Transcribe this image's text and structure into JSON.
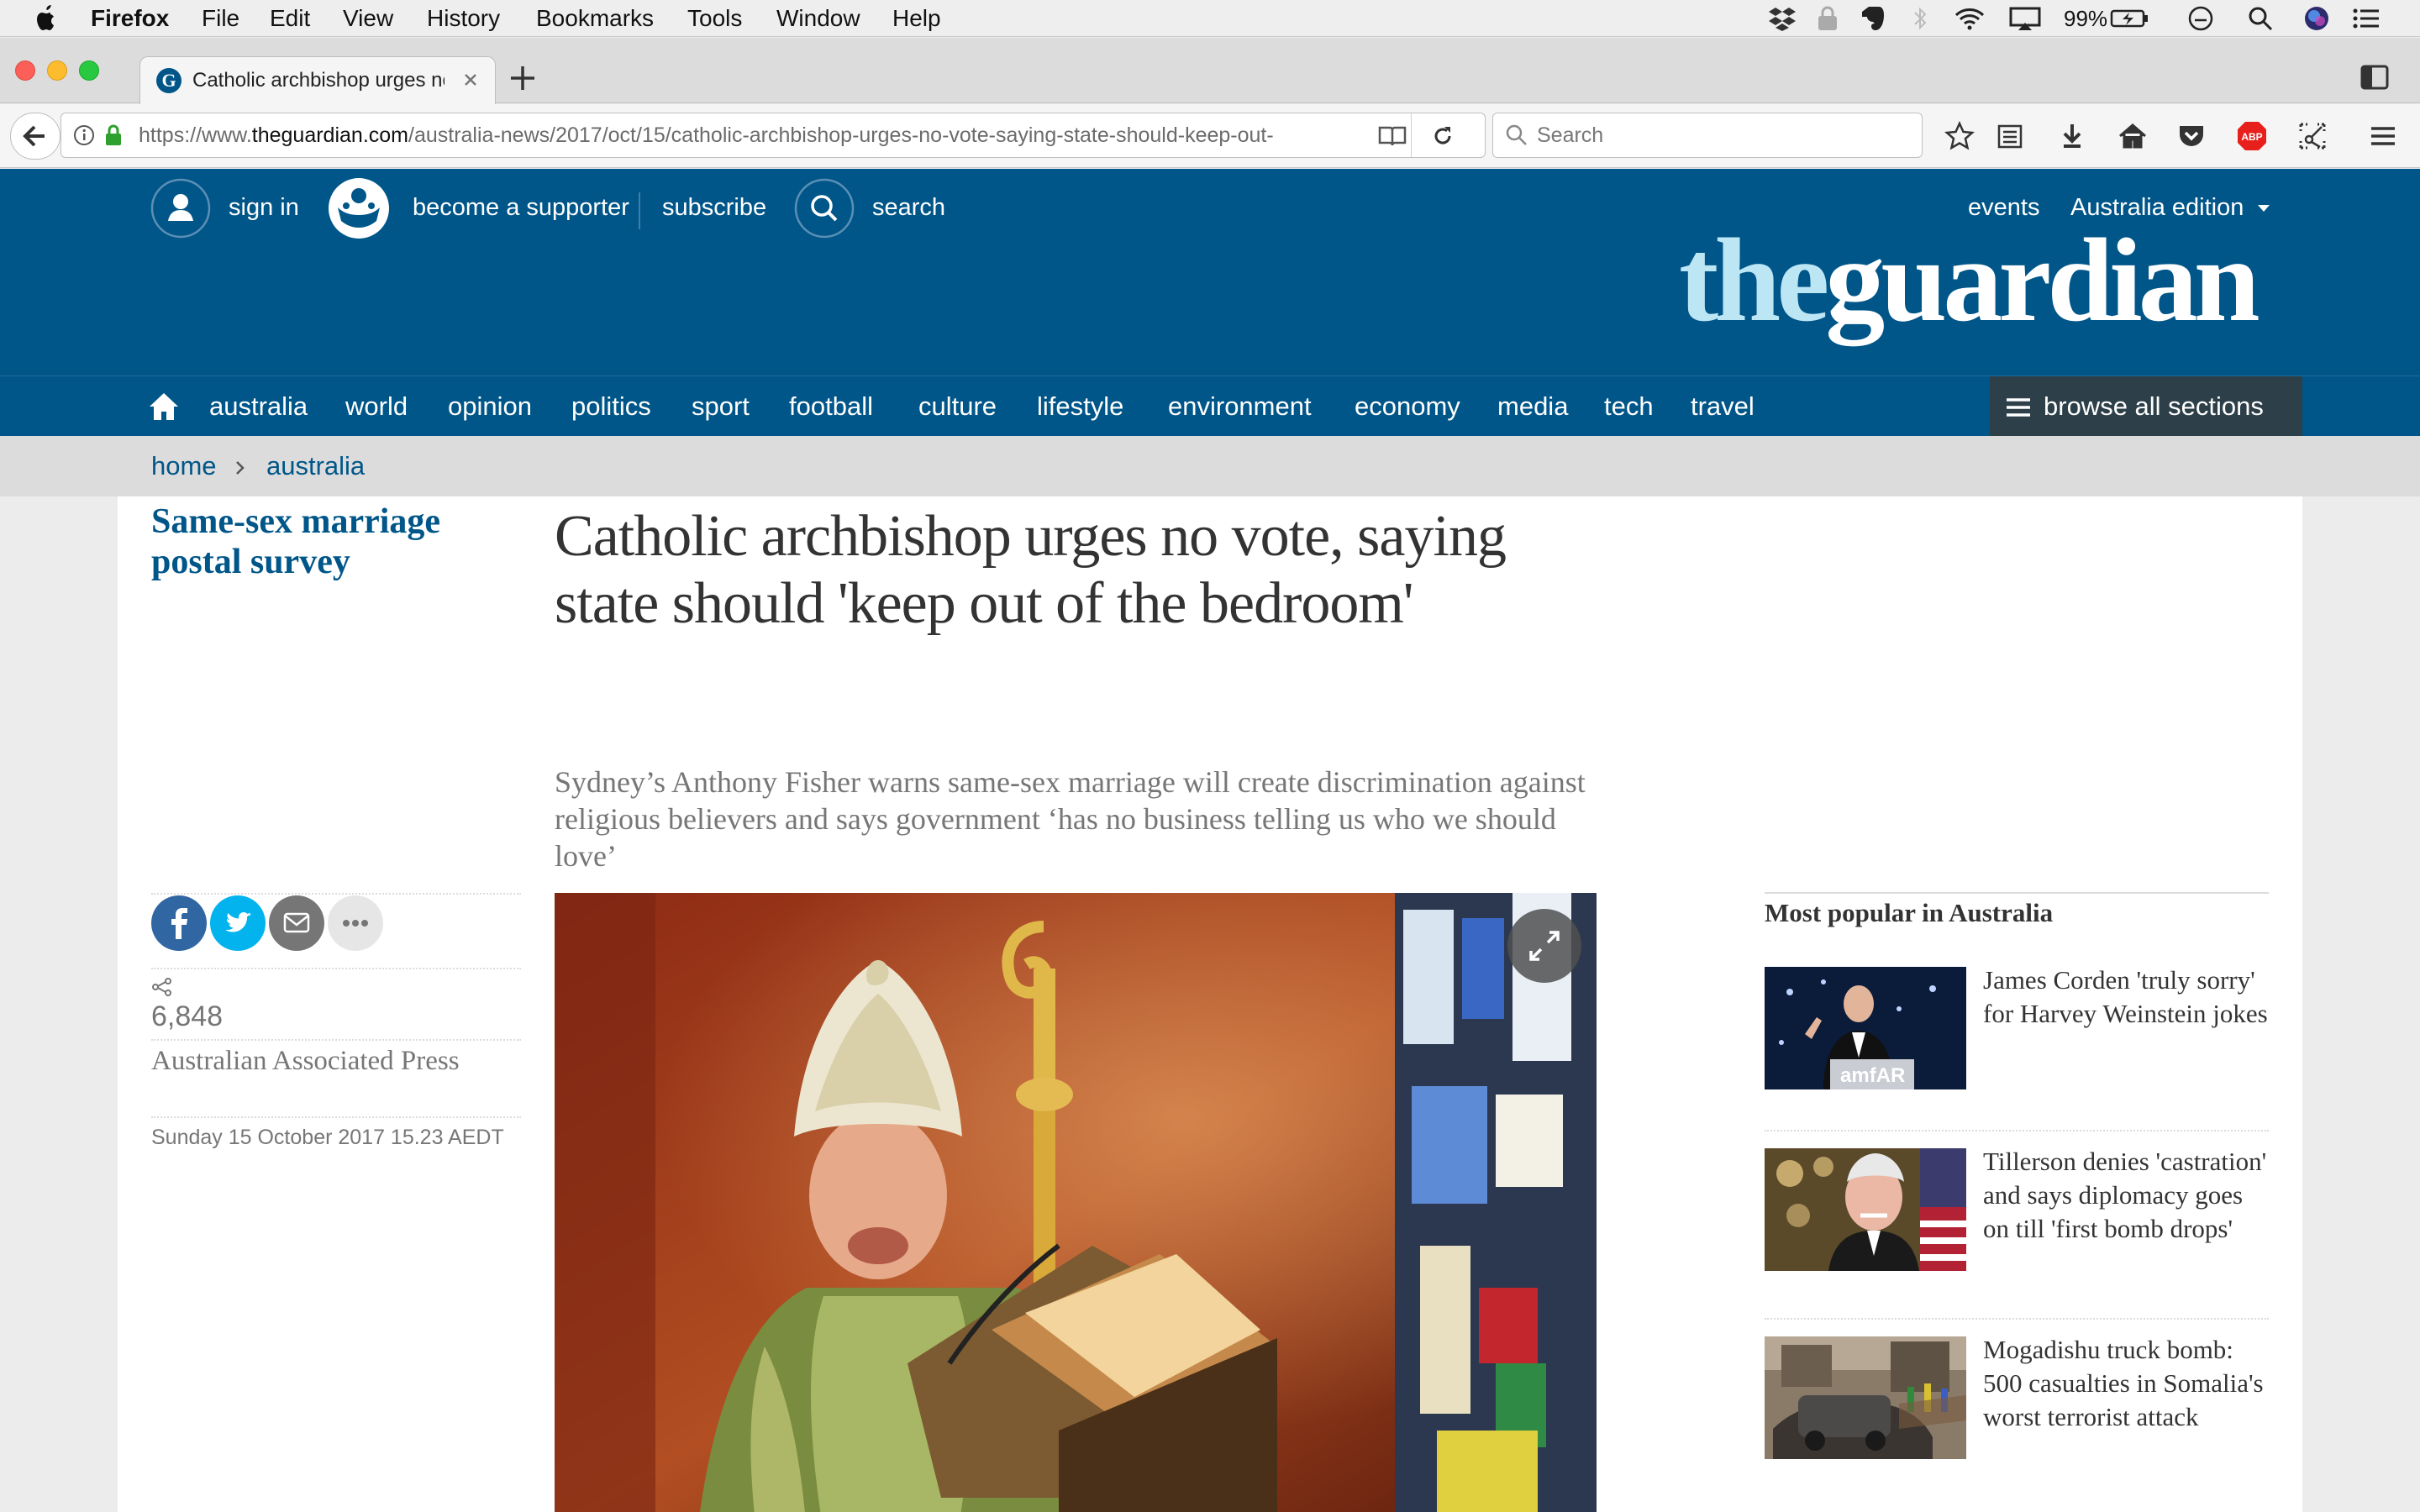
{
  "menubar": {
    "app": "Firefox",
    "items": [
      "File",
      "Edit",
      "View",
      "History",
      "Bookmarks",
      "Tools",
      "Window",
      "Help"
    ],
    "battery": "99%"
  },
  "browser": {
    "tab_title": "Catholic archbishop urges no",
    "url_prefix": "https://www.",
    "url_domain": "theguardian.com",
    "url_path": "/australia-news/2017/oct/15/catholic-archbishop-urges-no-vote-saying-state-should-keep-out-",
    "search_placeholder": "Search"
  },
  "masthead": {
    "sign_in": "sign in",
    "become_supporter": "become a supporter",
    "subscribe": "subscribe",
    "search": "search",
    "events": "events",
    "edition": "Australia edition",
    "logo_the": "the",
    "logo_guardian": "guardian"
  },
  "nav": {
    "items": [
      "australia",
      "world",
      "opinion",
      "politics",
      "sport",
      "football",
      "culture",
      "lifestyle",
      "environment",
      "economy",
      "media",
      "tech",
      "travel"
    ],
    "browse": "browse all sections"
  },
  "breadcrumb": {
    "home": "home",
    "section": "australia"
  },
  "article": {
    "series": "Same-sex marriage postal survey",
    "headline": "Catholic archbishop urges no vote, saying state should 'keep out of the bedroom'",
    "standfirst": "Sydney’s Anthony Fisher warns same-sex marriage will create discrimination against religious believers and says government ‘has no business telling us who we should love’",
    "share_count": "6,848",
    "byline": "Australian Associated Press",
    "date": "Sunday 15 October 2017 15.23 AEDT"
  },
  "popular": {
    "heading": "Most popular in Australia",
    "items": [
      {
        "title": "James Corden 'truly sorry' for Harvey Weinstein jokes",
        "thumb_caption": "amfAR"
      },
      {
        "title": "Tillerson denies 'castration' and says diplomacy goes on till 'first bomb drops'"
      },
      {
        "title": "Mogadishu truck bomb: 500 casualties in Somalia's worst terrorist attack"
      }
    ]
  },
  "colors": {
    "guardian_blue": "#005689",
    "logo_light": "#bde6f5",
    "browse_bg": "#2d3f49",
    "breadcrumb_bg": "#dcdcdc"
  }
}
